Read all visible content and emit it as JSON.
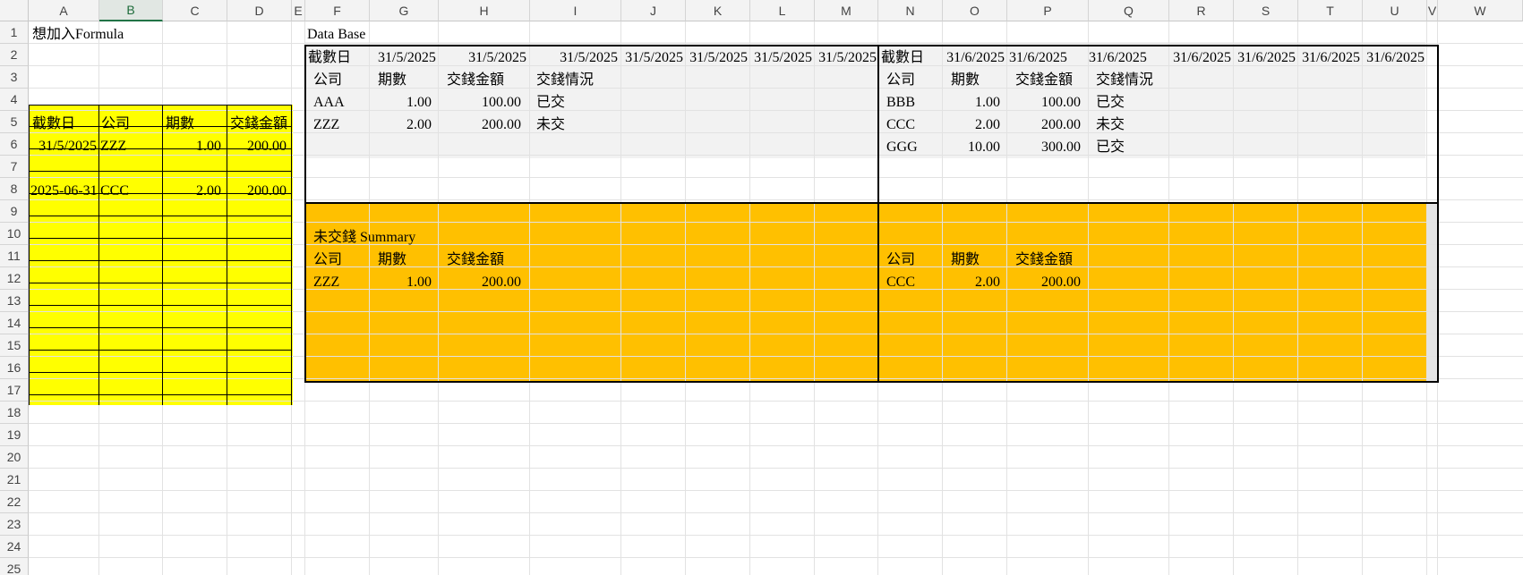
{
  "columns": [
    "A",
    "B",
    "C",
    "D",
    "E",
    "F",
    "G",
    "H",
    "I",
    "J",
    "K",
    "L",
    "M",
    "N",
    "O",
    "P",
    "Q",
    "R",
    "S",
    "T",
    "U",
    "V",
    "W"
  ],
  "rows": [
    "1",
    "2",
    "3",
    "4",
    "5",
    "6",
    "7",
    "8",
    "9",
    "10",
    "11",
    "12",
    "13",
    "14",
    "15",
    "16",
    "17",
    "18",
    "19",
    "20",
    "21",
    "22",
    "23",
    "24",
    "25"
  ],
  "selected_column": "B",
  "colors": {
    "yellow": "#ffff00",
    "orange": "#ffc000",
    "light_gray": "#f2f2f2",
    "header_gray": "#f3f3f3",
    "grid": "#e2e2e2"
  },
  "left": {
    "note": "想加入Formula",
    "headers": [
      "截數日",
      "公司",
      "期數",
      "交錢金額"
    ],
    "row6": {
      "date": "31/5/2025",
      "company": "ZZZ",
      "period": "1.00",
      "amount": "200.00"
    },
    "row8": {
      "date": "2025-06-31",
      "company": "CCC",
      "period": "2.00",
      "amount": "200.00"
    }
  },
  "db": {
    "title": "Data Base",
    "may": {
      "date_label": "截數日",
      "dates": [
        "31/5/2025",
        "31/5/2025",
        "31/5/2025",
        "31/5/2025",
        "31/5/2025",
        "31/5/2025",
        "31/5/2025"
      ],
      "headers": [
        "公司",
        "期數",
        "交錢金額",
        "交錢情況"
      ],
      "records": [
        {
          "company": "AAA",
          "period": "1.00",
          "amount": "100.00",
          "status": "已交"
        },
        {
          "company": "ZZZ",
          "period": "2.00",
          "amount": "200.00",
          "status": "未交"
        }
      ]
    },
    "june": {
      "date_label": "截數日",
      "dates": [
        "31/6/2025",
        "31/6/2025",
        "31/6/2025",
        "31/6/2025",
        "31/6/2025",
        "31/6/2025",
        "31/6/2025"
      ],
      "headers": [
        "公司",
        "期數",
        "交錢金額",
        "交錢情況"
      ],
      "records": [
        {
          "company": "BBB",
          "period": "1.00",
          "amount": "100.00",
          "status": "已交"
        },
        {
          "company": "CCC",
          "period": "2.00",
          "amount": "200.00",
          "status": "未交"
        },
        {
          "company": "GGG",
          "period": "10.00",
          "amount": "300.00",
          "status": "已交"
        }
      ]
    },
    "summary_may": {
      "title": "未交錢 Summary",
      "headers": [
        "公司",
        "期數",
        "交錢金額"
      ],
      "records": [
        {
          "company": "ZZZ",
          "period": "1.00",
          "amount": "200.00"
        }
      ]
    },
    "summary_june": {
      "headers": [
        "公司",
        "期數",
        "交錢金額"
      ],
      "records": [
        {
          "company": "CCC",
          "period": "2.00",
          "amount": "200.00"
        }
      ]
    }
  }
}
